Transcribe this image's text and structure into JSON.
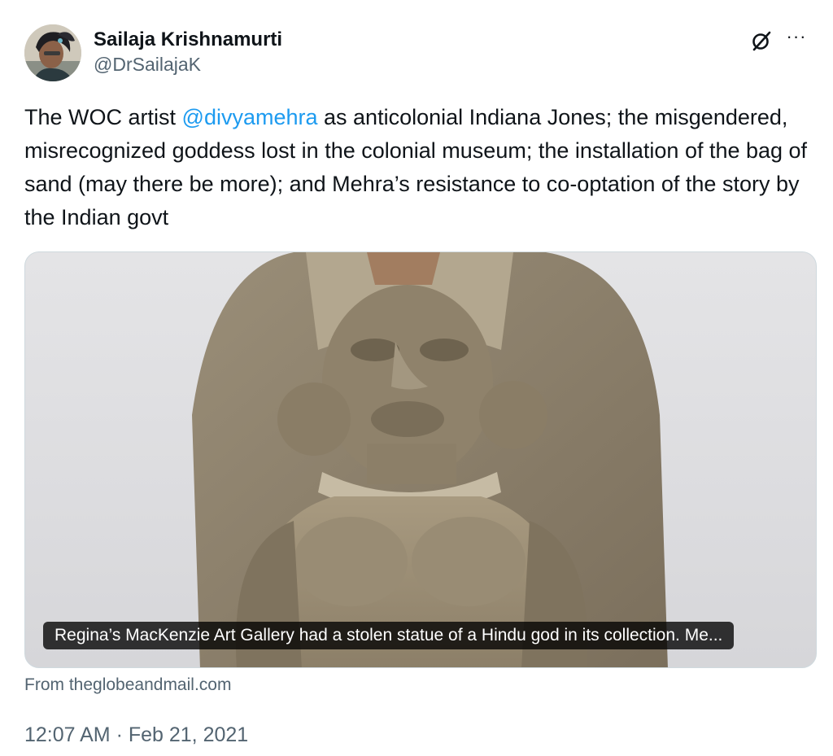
{
  "author": {
    "display_name": "Sailaja Krishnamurti",
    "handle": "@DrSailajaK"
  },
  "actions": {
    "grok_icon": "grok-icon",
    "more_icon": "more-icon",
    "more_label": "···"
  },
  "tweet": {
    "text_before": "The WOC artist ",
    "mention": "@divyamehra",
    "text_after": " as anticolonial Indiana Jones; the misgendered, misrecognized goddess lost in the colonial museum; the installation of the bag of sand (may there be more); and Mehra’s resistance to co-optation of the story by the Indian govt"
  },
  "card": {
    "caption": "Regina’s MacKenzie Art Gallery had a stolen statue of a Hindu god in its collection. Me...",
    "source": "From theglobeandmail.com"
  },
  "meta": {
    "timestamp": "12:07 AM · Feb 21, 2021"
  },
  "colors": {
    "link": "#1d9bf0",
    "secondary_text": "#536471",
    "primary_text": "#0f1419"
  }
}
